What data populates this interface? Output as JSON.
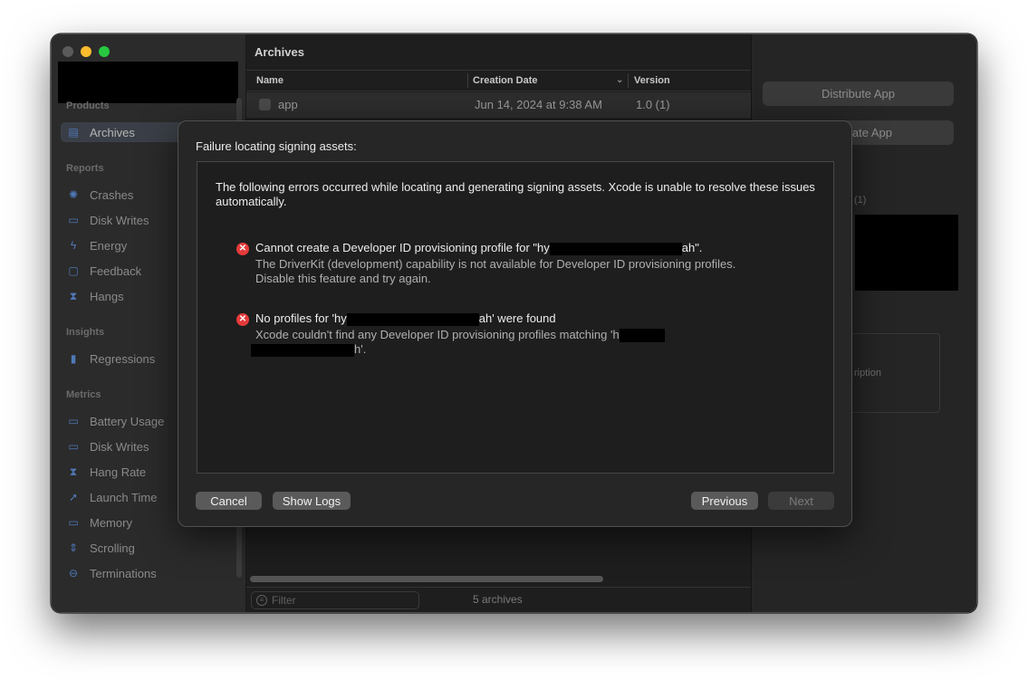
{
  "window": {
    "title_redacted": true
  },
  "sidebar": {
    "sections": {
      "products": "Products",
      "reports": "Reports",
      "insights": "Insights",
      "metrics": "Metrics"
    },
    "archives": {
      "label": "Archives",
      "icon": "archive-icon"
    },
    "reports": [
      {
        "label": "Crashes",
        "icon": "crash-icon"
      },
      {
        "label": "Disk Writes",
        "icon": "disk-icon"
      },
      {
        "label": "Energy",
        "icon": "bolt-icon"
      },
      {
        "label": "Feedback",
        "icon": "feedback-icon"
      },
      {
        "label": "Hangs",
        "icon": "hourglass-icon"
      }
    ],
    "insights": [
      {
        "label": "Regressions",
        "icon": "regression-chart-icon"
      }
    ],
    "metrics": [
      {
        "label": "Battery Usage",
        "icon": "battery-icon"
      },
      {
        "label": "Disk Writes",
        "icon": "disk-icon"
      },
      {
        "label": "Hang Rate",
        "icon": "hourglass-icon"
      },
      {
        "label": "Launch Time",
        "icon": "rocket-icon"
      },
      {
        "label": "Memory",
        "icon": "memory-icon"
      },
      {
        "label": "Scrolling",
        "icon": "scroll-icon"
      },
      {
        "label": "Terminations",
        "icon": "termination-icon"
      }
    ]
  },
  "main": {
    "title": "Archives",
    "columns": {
      "name": "Name",
      "date": "Creation Date",
      "version": "Version"
    },
    "rows": [
      {
        "name": "app",
        "date": "Jun 14, 2024 at 9:38 AM",
        "version": "1.0 (1)"
      }
    ],
    "filter_placeholder": "Filter",
    "count": "5 archives"
  },
  "inspector": {
    "distribute": "Distribute App",
    "validate_partial": "ate App",
    "version_partial": "(1)",
    "description_partial": "ription"
  },
  "sheet": {
    "title": "Failure locating signing assets:",
    "intro": "The following errors occurred while locating and generating signing assets. Xcode is unable to resolve these issues automatically.",
    "errors": [
      {
        "title_start": "Cannot create a Developer ID provisioning profile for \"hy",
        "title_end": "ah\".",
        "desc_line1": "The DriverKit (development) capability is not available for Developer ID provisioning profiles.",
        "desc_line2": "Disable this feature and try again."
      },
      {
        "title_start": "No profiles for 'hy",
        "title_end": "ah' were found",
        "desc_start": "Xcode couldn't find any Developer ID provisioning profiles matching 'h",
        "desc_end": "h'."
      }
    ],
    "buttons": {
      "cancel": "Cancel",
      "show_logs": "Show Logs",
      "previous": "Previous",
      "next": "Next"
    }
  }
}
